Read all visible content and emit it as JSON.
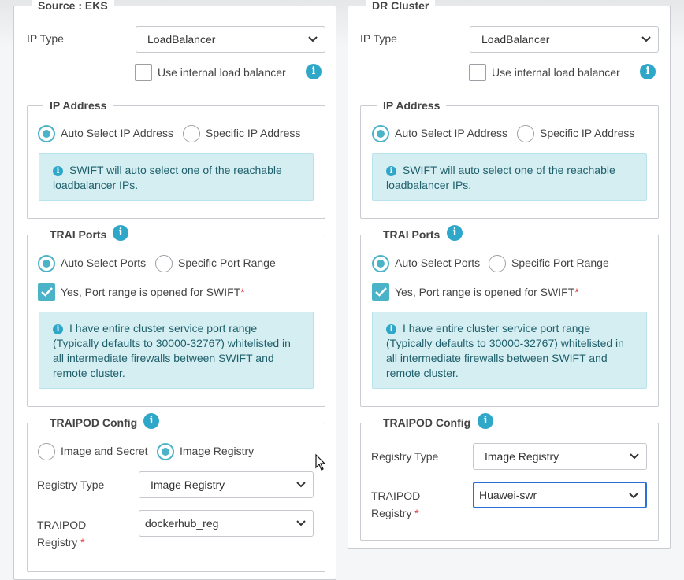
{
  "left": {
    "title": "Source : EKS",
    "ip_type_label": "IP Type",
    "ip_type_value": "LoadBalancer",
    "internal_lb_label": "Use internal load balancer",
    "internal_lb_checked": false,
    "ip_address": {
      "title": "IP Address",
      "opt_auto": "Auto Select IP Address",
      "opt_specific": "Specific IP Address",
      "selected": "auto",
      "alert": "SWIFT will auto select one of the reachable loadbalancer IPs."
    },
    "trai_ports": {
      "title": "TRAI Ports",
      "opt_auto": "Auto Select Ports",
      "opt_specific": "Specific Port Range",
      "selected": "auto",
      "confirm_label": "Yes, Port range is opened for SWIFT",
      "confirm_required": "*",
      "confirm_checked": true,
      "alert": "I have entire cluster service port range (Typically defaults to 30000-32767) whitelisted in all intermediate firewalls between SWIFT and remote cluster."
    },
    "traipod": {
      "title": "TRAIPOD Config",
      "opt_secret": "Image and Secret",
      "opt_registry": "Image Registry",
      "selected": "registry",
      "registry_type_label": "Registry Type",
      "registry_type_value": "Image Registry",
      "registry_label_line1": "TRAIPOD",
      "registry_label_line2": "Registry",
      "registry_required": "*",
      "registry_value": "dockerhub_reg"
    }
  },
  "right": {
    "title": "DR Cluster",
    "ip_type_label": "IP Type",
    "ip_type_value": "LoadBalancer",
    "internal_lb_label": "Use internal load balancer",
    "internal_lb_checked": false,
    "ip_address": {
      "title": "IP Address",
      "opt_auto": "Auto Select IP Address",
      "opt_specific": "Specific IP Address",
      "selected": "auto",
      "alert": "SWIFT will auto select one of the reachable loadbalancer IPs."
    },
    "trai_ports": {
      "title": "TRAI Ports",
      "opt_auto": "Auto Select Ports",
      "opt_specific": "Specific Port Range",
      "selected": "auto",
      "confirm_label": "Yes, Port range is opened for SWIFT",
      "confirm_required": "*",
      "confirm_checked": true,
      "alert": "I have entire cluster service port range (Typically defaults to 30000-32767) whitelisted in all intermediate firewalls between SWIFT and remote cluster."
    },
    "traipod": {
      "title": "TRAIPOD Config",
      "registry_type_label": "Registry Type",
      "registry_type_value": "Image Registry",
      "registry_label_line1": "TRAIPOD",
      "registry_label_line2": "Registry",
      "registry_required": "*",
      "registry_value": "Huawei-swr"
    }
  },
  "icons": {
    "info": "info-circle-icon",
    "chevron": "chevron-down-icon",
    "check": "checkmark-icon",
    "cursor": "mouse-pointer-icon"
  },
  "colors": {
    "accent": "#4bb3c8",
    "info_icon": "#2fa7c9",
    "alert_bg": "#d4eef2",
    "alert_text": "#1e5f6b",
    "focus_border": "#2b6fd6",
    "required": "#dd3333"
  }
}
